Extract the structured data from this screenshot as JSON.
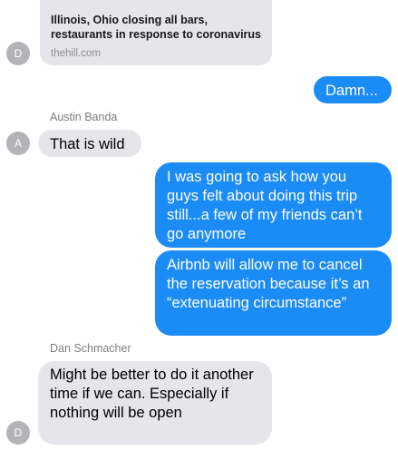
{
  "colors": {
    "incoming_bubble": "#e5e5ea",
    "outgoing_bubble": "#1b8bf5",
    "avatar": "#b3b3b8",
    "sender_name": "#7e7e83"
  },
  "link_preview": {
    "title": "Illinois, Ohio closing all bars, restaurants in response to coronavirus",
    "domain": "thehill.com",
    "avatar_initial": "D"
  },
  "messages": [
    {
      "direction": "outgoing",
      "text": "Damn..."
    },
    {
      "direction": "incoming",
      "sender": "Austin Banda",
      "avatar_initial": "A",
      "text": "That is wild"
    },
    {
      "direction": "outgoing",
      "text": "I was going to ask how you guys felt about doing this trip still...a few of my friends can’t go anymore"
    },
    {
      "direction": "outgoing",
      "text": "Airbnb will allow me to cancel the reservation because it’s an “extenuating circumstance”"
    },
    {
      "direction": "incoming",
      "sender": "Dan Schmacher",
      "avatar_initial": "D",
      "text": "Might be better to do it another time if we can. Especially if nothing will be open"
    }
  ]
}
